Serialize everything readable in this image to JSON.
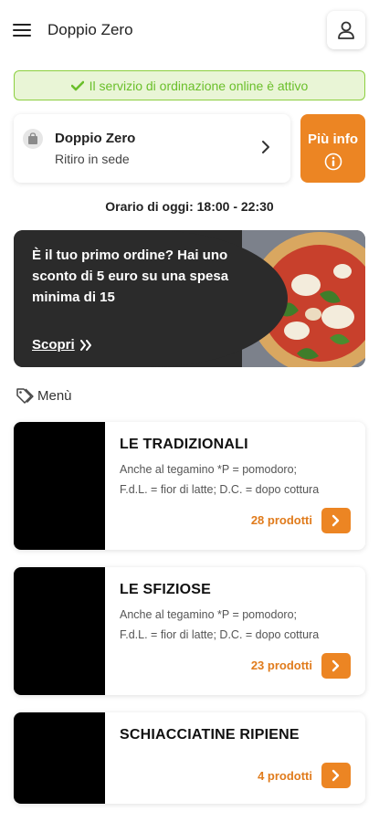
{
  "header": {
    "title": "Doppio Zero",
    "menu_icon": "hamburger-icon",
    "user_icon": "user-icon"
  },
  "service_banner": {
    "text": "Il servizio di ordinazione online è attivo",
    "icon": "check-icon",
    "text_color": "#6abf2a",
    "background": "#e9f5d6"
  },
  "store": {
    "name": "Doppio Zero",
    "mode": "Ritiro in sede",
    "icon": "store-bag-icon"
  },
  "more_info": {
    "label": "Più info",
    "icon": "info-icon",
    "color": "#ec8523"
  },
  "hours": {
    "text": "Orario di oggi: 18:00 - 22:30"
  },
  "promo": {
    "text": "È il tuo primo ordine? Hai uno sconto di 5 euro su una spesa minima di 15",
    "link_label": "Scopri",
    "link_icon": "double-chevron-right-icon"
  },
  "menu": {
    "heading": "Menù",
    "icon": "tag-icon",
    "categories": [
      {
        "title": "LE TRADIZIONALI",
        "desc_line1": "Anche al tegamino *P = pomodoro;",
        "desc_line2": "F.d.L. = fior di latte; D.C. = dopo cottura",
        "count": "28 prodotti"
      },
      {
        "title": "LE SFIZIOSE",
        "desc_line1": "Anche al tegamino *P = pomodoro;",
        "desc_line2": "F.d.L. = fior di latte; D.C. = dopo cottura",
        "count": "23 prodotti"
      },
      {
        "title": "SCHIACCIATINE RIPIENE",
        "desc_line1": "",
        "desc_line2": "",
        "count": "4 prodotti"
      }
    ]
  }
}
